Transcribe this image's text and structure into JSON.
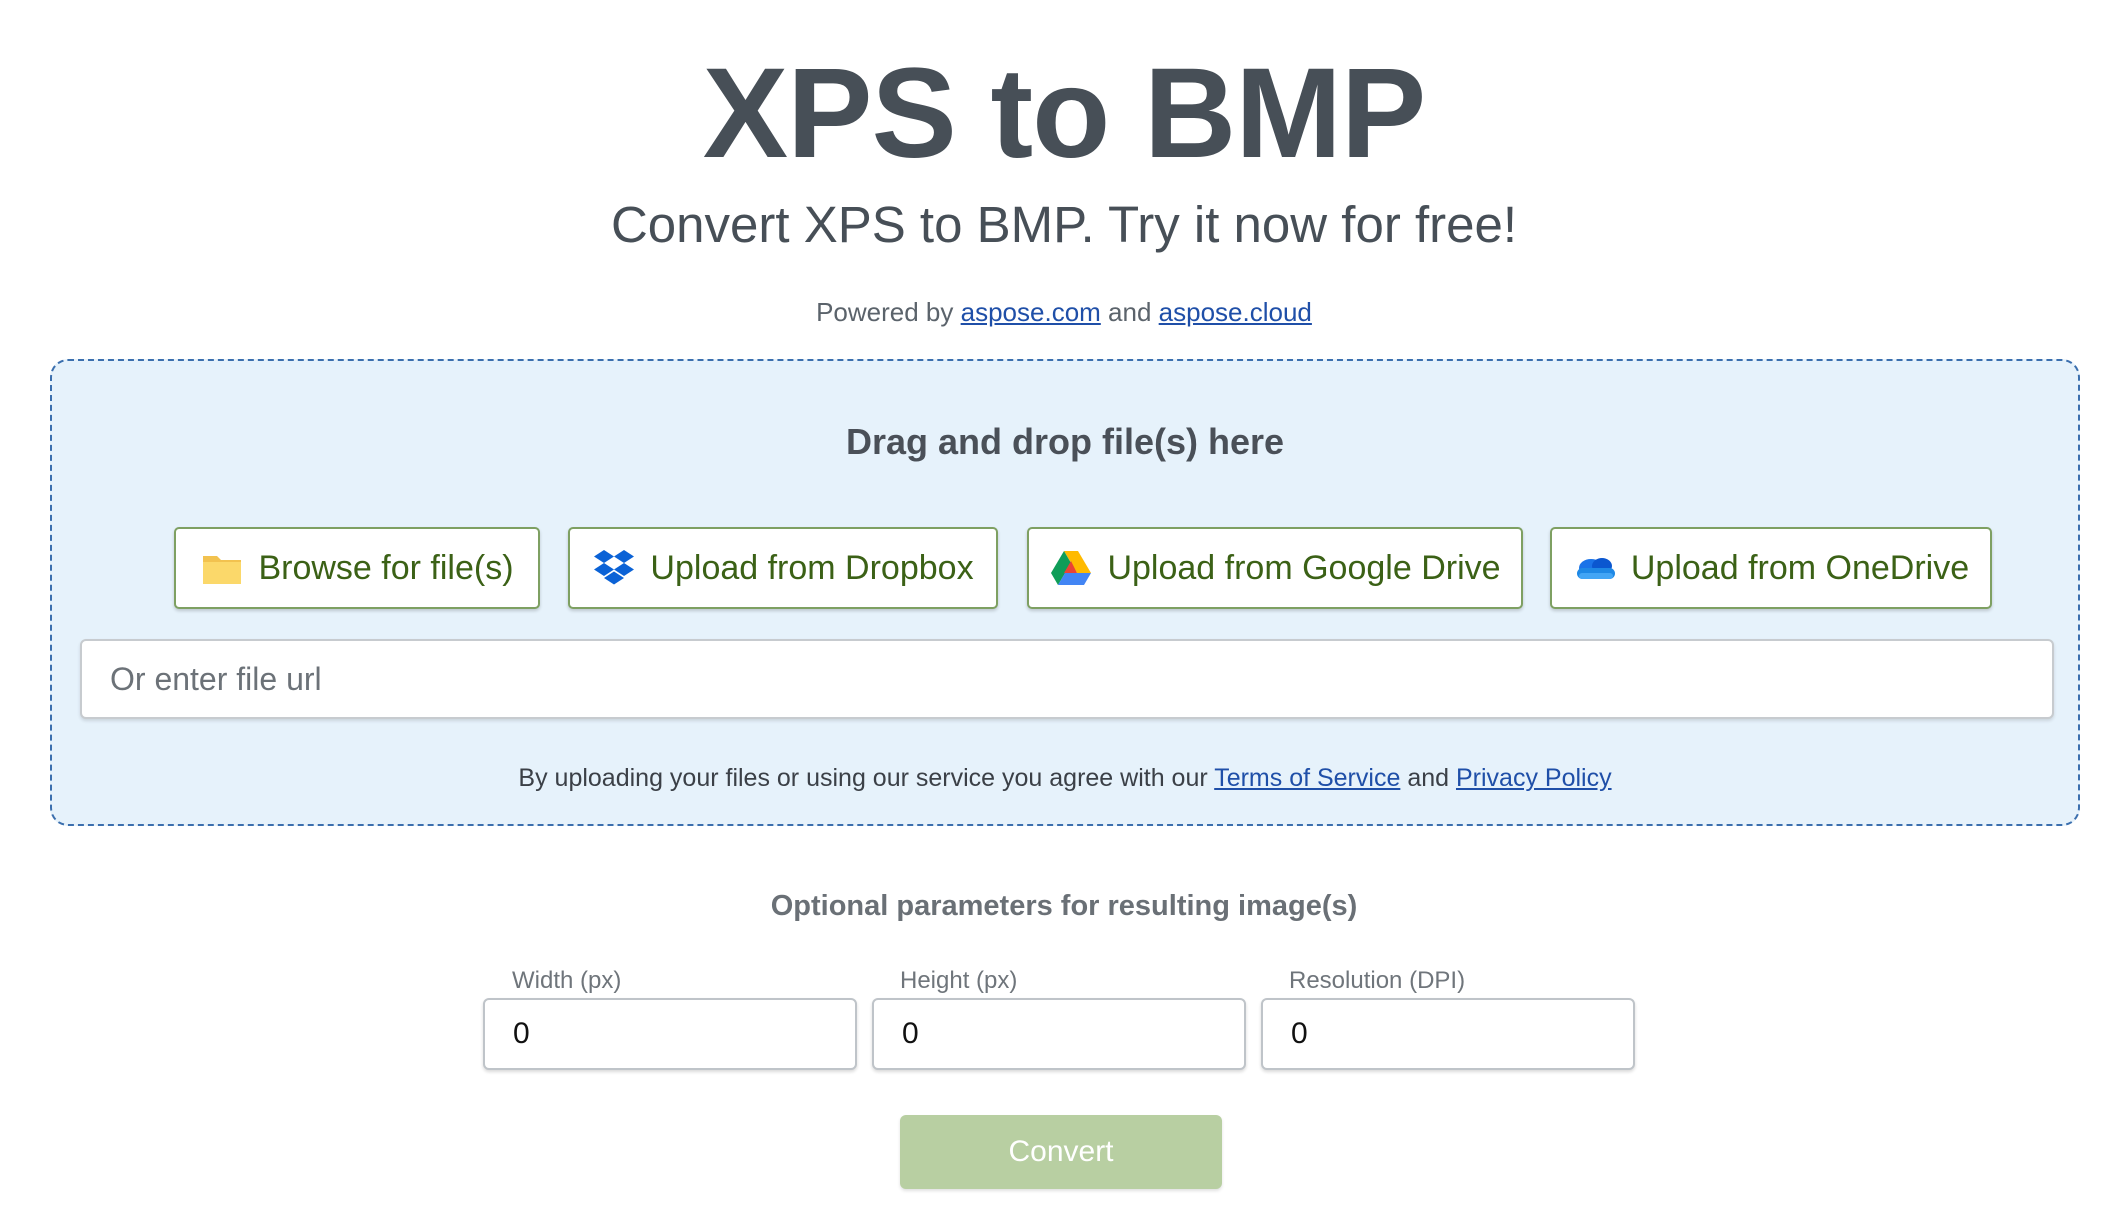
{
  "header": {
    "title": "XPS to BMP",
    "subtitle": "Convert XPS to BMP. Try it now for free!",
    "powered_prefix": "Powered by",
    "powered_link1": "aspose.com",
    "powered_and": "and",
    "powered_link2": "aspose.cloud"
  },
  "upload": {
    "drag_text": "Drag and drop file(s) here",
    "buttons": [
      {
        "label": "Browse for file(s)",
        "icon": "folder-icon"
      },
      {
        "label": "Upload from Dropbox",
        "icon": "dropbox-icon"
      },
      {
        "label": "Upload from Google Drive",
        "icon": "google-drive-icon"
      },
      {
        "label": "Upload from OneDrive",
        "icon": "onedrive-icon"
      }
    ],
    "url_placeholder": "Or enter file url",
    "terms_prefix": "By uploading your files or using our service you agree with our",
    "terms_link": "Terms of Service",
    "terms_and": "and",
    "privacy_link": "Privacy Policy"
  },
  "options": {
    "title": "Optional parameters for resulting image(s)",
    "width_label": "Width (px)",
    "width_value": "0",
    "height_label": "Height (px)",
    "height_value": "0",
    "resolution_label": "Resolution (DPI)",
    "resolution_value": "0"
  },
  "convert_label": "Convert",
  "colors": {
    "accent_green": "#3b6116",
    "button_border": "#7ea062",
    "convert_disabled": "#b8cfa2",
    "dropzone_bg": "#e6f2fb",
    "dropzone_border": "#3b6fae",
    "link": "#1f4fa8"
  }
}
